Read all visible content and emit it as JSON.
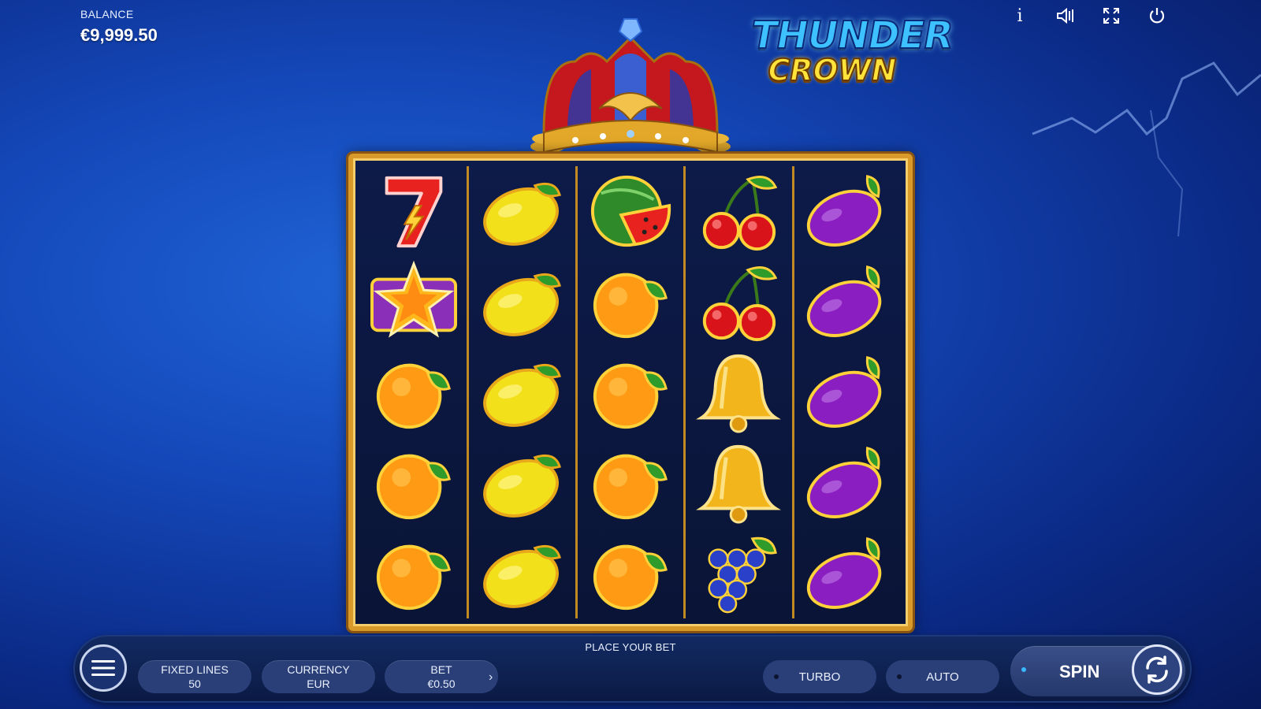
{
  "balance": {
    "label": "BALANCE",
    "value": "€9,999.50"
  },
  "top_icons": [
    "info-icon",
    "sound-icon",
    "fullscreen-icon",
    "power-icon"
  ],
  "top_icon_glyphs": {
    "info": "i"
  },
  "logo": {
    "line1": "THUNDER",
    "line2": "CROWN"
  },
  "reels": [
    [
      "seven",
      "star",
      "orange",
      "orange",
      "orange"
    ],
    [
      "lemon",
      "lemon",
      "lemon",
      "lemon",
      "lemon"
    ],
    [
      "watermelon",
      "orange",
      "orange",
      "orange",
      "orange"
    ],
    [
      "cherry",
      "cherry",
      "bell",
      "bell",
      "grapes"
    ],
    [
      "plum",
      "plum",
      "plum",
      "plum",
      "plum"
    ]
  ],
  "bottom_bar": {
    "status": "PLACE YOUR BET",
    "fixed_lines": {
      "label": "FIXED LINES",
      "value": "50"
    },
    "currency": {
      "label": "CURRENCY",
      "value": "EUR"
    },
    "bet": {
      "label": "BET",
      "value": "€0.50"
    },
    "turbo": "TURBO",
    "auto": "AUTO",
    "spin": "SPIN"
  },
  "colors": {
    "frame": "#d99a2a",
    "accent": "#3ab8ff",
    "background": "#1447b8"
  }
}
